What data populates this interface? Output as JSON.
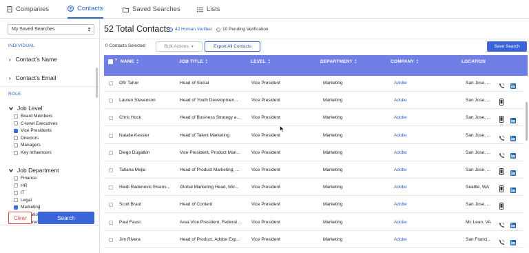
{
  "nav": {
    "tabs": [
      {
        "label": "Companies",
        "icon": "building-icon",
        "active": false
      },
      {
        "label": "Contacts",
        "icon": "user-icon",
        "active": true
      },
      {
        "label": "Saved Searches",
        "icon": "folder-icon",
        "active": false
      },
      {
        "label": "Lists",
        "icon": "list-icon",
        "active": false
      }
    ]
  },
  "sidebar": {
    "saved_search_select": "My Saved Searches",
    "individual_label": "INDIVIDUAL",
    "contact_name": "Contact's Name",
    "contact_email": "Contact's Email",
    "role_label": "ROLE",
    "job_level": {
      "title": "Job Level",
      "options": [
        {
          "label": "Board Members",
          "checked": false
        },
        {
          "label": "C-level Executives",
          "checked": false
        },
        {
          "label": "Vice Presidents",
          "checked": true
        },
        {
          "label": "Directors",
          "checked": false
        },
        {
          "label": "Managers",
          "checked": false
        },
        {
          "label": "Key Influencers",
          "checked": false
        }
      ]
    },
    "job_department": {
      "title": "Job Department",
      "options": [
        {
          "label": "Finance",
          "checked": false
        },
        {
          "label": "HR",
          "checked": false
        },
        {
          "label": "IT",
          "checked": false
        },
        {
          "label": "Legal",
          "checked": false
        },
        {
          "label": "Marketing",
          "checked": true
        },
        {
          "label": "Operations",
          "checked": false
        },
        {
          "label": "Procurement",
          "checked": false
        }
      ]
    },
    "clear_label": "Clear",
    "search_label": "Search"
  },
  "main": {
    "title": "52 Total Contacts",
    "human_verified": "42 Human Verified",
    "pending": "10 Pending Verification",
    "selected_count": "0 Contacts Selected",
    "bulk_actions": "Bulk Actions",
    "export_all": "Export All Contacts",
    "save_search": "Save Search",
    "columns": [
      "NAME",
      "JOB TITLE",
      "LEVEL",
      "DEPARTMENT",
      "COMPANY",
      "LOCATION"
    ],
    "rows": [
      {
        "name": "Ofir Tahor",
        "title": "Head of Social",
        "level": "Vice President",
        "dept": "Marketing",
        "company": "Adobe",
        "location": "San Jose, ...",
        "phone": true,
        "mobile": false,
        "linkedin": true
      },
      {
        "name": "Lauren Stevenson",
        "title": "Head of Youth Developmen...",
        "level": "Vice President",
        "dept": "Marketing",
        "company": "Adobe",
        "location": "San Jose, ...",
        "phone": false,
        "mobile": true,
        "linkedin": false
      },
      {
        "name": "Chris Hock",
        "title": "Head of Business Strategy a...",
        "level": "Vice President",
        "dept": "Marketing",
        "company": "Adobe",
        "location": "San Jose, ...",
        "phone": false,
        "mobile": true,
        "linkedin": true
      },
      {
        "name": "Natalie Kessler",
        "title": "Head of Talent Marketing",
        "level": "Vice President",
        "dept": "Marketing",
        "company": "Adobe",
        "location": "San Jose, ...",
        "phone": true,
        "mobile": false,
        "linkedin": true
      },
      {
        "name": "Diego Dugatkin",
        "title": "Vice President, Product Man...",
        "level": "Vice President",
        "dept": "Marketing",
        "company": "Adobe",
        "location": "San Jose, ...",
        "phone": true,
        "mobile": false,
        "linkedin": true
      },
      {
        "name": "Tatiana Mejia",
        "title": "Head of Product Marketing, ...",
        "level": "Vice President",
        "dept": "Marketing",
        "company": "Adobe",
        "location": "San Jose, ...",
        "phone": false,
        "mobile": true,
        "linkedin": true
      },
      {
        "name": "Heidi Radenovic Eisens...",
        "title": "Global Marketing Head, Mic...",
        "level": "Vice President",
        "dept": "Marketing",
        "company": "Adobe",
        "location": "Seattle, WA",
        "phone": false,
        "mobile": true,
        "linkedin": true
      },
      {
        "name": "Scott Braut",
        "title": "Head of Content",
        "level": "Vice President",
        "dept": "Marketing",
        "company": "Adobe",
        "location": "San Jose, ...",
        "phone": false,
        "mobile": true,
        "linkedin": false
      },
      {
        "name": "Paul Faust",
        "title": "Area Vice President, Federal ...",
        "level": "Vice President",
        "dept": "Marketing",
        "company": "Adobe",
        "location": "Mc Lean, VA",
        "phone": true,
        "mobile": false,
        "linkedin": true
      },
      {
        "name": "Jim Rivera",
        "title": "Head of Product, Adobe Exp...",
        "level": "Vice President",
        "dept": "Marketing",
        "company": "Adobe",
        "location": "San Franci...",
        "phone": true,
        "mobile": false,
        "linkedin": true
      }
    ]
  }
}
